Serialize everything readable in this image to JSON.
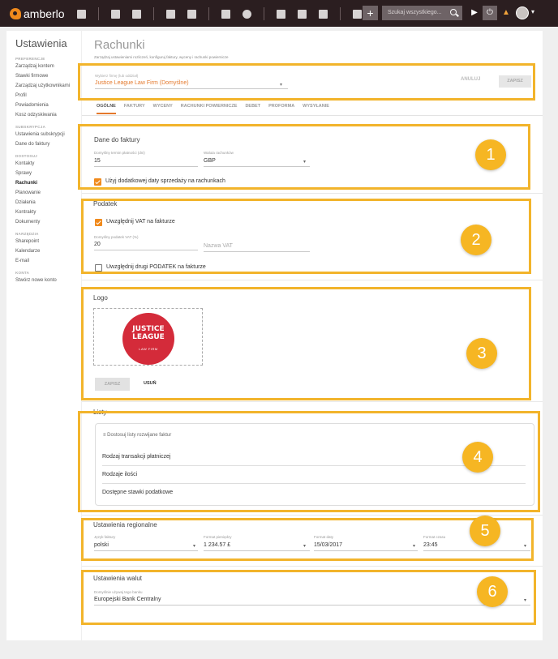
{
  "app": {
    "name": "amberlo"
  },
  "topbar": {
    "search_placeholder": "Szukaj wszystkiego...",
    "nav_icons": [
      "dashboard-icon",
      "clients-icon",
      "building-icon",
      "document-icon",
      "bank-icon",
      "calendar-icon",
      "whatsapp-icon",
      "folder-icon",
      "file-icon",
      "mail-icon",
      "table-icon"
    ],
    "plus_label": "+",
    "avatar_caret": "▾"
  },
  "sidebar": {
    "title": "Ustawienia",
    "sections": [
      {
        "title": "PREFERENCJE",
        "items": [
          "Zarządzaj kontem",
          "Stawki firmowe",
          "Zarządzaj użytkownikami",
          "Profil",
          "Powiadomienia",
          "Kosz odzyskiwania"
        ]
      },
      {
        "title": "SUBSKRYPCJA",
        "items": [
          "Ustawienia subskrypcji",
          "Dane do faktury"
        ]
      },
      {
        "title": "DOSTOSUJ",
        "items": [
          "Kontakty",
          "Sprawy",
          "Rachunki",
          "Planowanie",
          "Działania",
          "Kontrakty",
          "Dokumenty"
        ]
      },
      {
        "title": "NARZĘDZIA",
        "items": [
          "Sharepoint",
          "Kalendarze",
          "E-mail"
        ]
      },
      {
        "title": "KONTA",
        "items": [
          "Stwórz nowe konto"
        ]
      }
    ],
    "active_item": "Rachunki"
  },
  "main": {
    "title": "Rachunki",
    "subtitle": "Zarządzaj ustawieniami rozliczeń, konfiguruj faktury, wyceny i rachunki powiernicze",
    "firm_select": {
      "label": "Wybierz firmę (lub oddział)",
      "value": "Justice League Law Firm (Domyślne)",
      "cancel_label": "ANULUJ",
      "save_label": "ZAPISZ"
    },
    "tabs": [
      "OGÓLNE",
      "FAKTURY",
      "WYCENY",
      "RACHUNKI POWIERNICZE",
      "DEBET",
      "PROFORMA",
      "WYSYŁANIE"
    ],
    "invoice_data": {
      "title": "Dane do faktury",
      "due_label": "Domyślny termin płatności (dni)",
      "due_value": "15",
      "currency_label": "Waluta rachunków",
      "currency_value": "GBP",
      "extra_date_label": "Użyj dodatkowej daty sprzedaży na rachunkach",
      "extra_date_checked": true
    },
    "tax": {
      "title": "Podatek",
      "vat_label": "Uwzględnij VAT na fakturze",
      "vat_checked": true,
      "rate_label": "Domyślny podatek VAT (%)",
      "rate_value": "20",
      "vat_name_placeholder": "Nazwa VAT",
      "second_tax_label": "Uwzględnij drugi PODATEK na fakturze",
      "second_tax_checked": false
    },
    "logo": {
      "title": "Logo",
      "brand_line1": "JUSTICE",
      "brand_line2": "LEAGUE",
      "brand_line3": "LAW FIRM",
      "save_label": "ZAPISZ",
      "delete_label": "USUŃ"
    },
    "lists": {
      "title": "Listy",
      "header": "Dostosuj listy rozwijane faktur",
      "rows": [
        "Rodzaj transakcji płatniczej",
        "Rodzaje ilości",
        "Dostępne stawki podatkowe"
      ]
    },
    "regional": {
      "title": "Ustawienia regionalne",
      "fields": [
        {
          "label": "Język faktury",
          "value": "polski"
        },
        {
          "label": "Format pieniędzy",
          "value": "1 234.57 £"
        },
        {
          "label": "Format daty",
          "value": "15/03/2017"
        },
        {
          "label": "Format czasu",
          "value": "23:45"
        }
      ]
    },
    "currency": {
      "title": "Ustawienia walut",
      "bank_label": "Domyślnie używaj tego banku",
      "bank_value": "Europejski Bank Centralny"
    }
  },
  "callouts": [
    "1",
    "2",
    "3",
    "4",
    "5",
    "6"
  ],
  "colors": {
    "accent": "#f08a1c",
    "highlight": "#f2b42b",
    "topbar": "#2b1e20"
  }
}
